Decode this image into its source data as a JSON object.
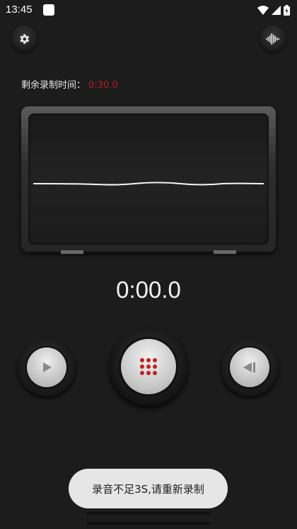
{
  "status_bar": {
    "time": "13:45"
  },
  "header": {
    "settings_icon": "gear-icon",
    "waveform_icon": "audio-waveform-icon"
  },
  "remaining": {
    "label": "剩余录制时间：",
    "value": "0:30.0",
    "value_color": "#b31b1b"
  },
  "timer": {
    "text": "0:00.0"
  },
  "controls": {
    "play_icon": "play-icon",
    "record_icon": "record-dots-icon",
    "record_color": "#c41f1f",
    "rewind_icon": "rewind-icon"
  },
  "toast": {
    "text": "录音不足3S,请重新录制"
  }
}
